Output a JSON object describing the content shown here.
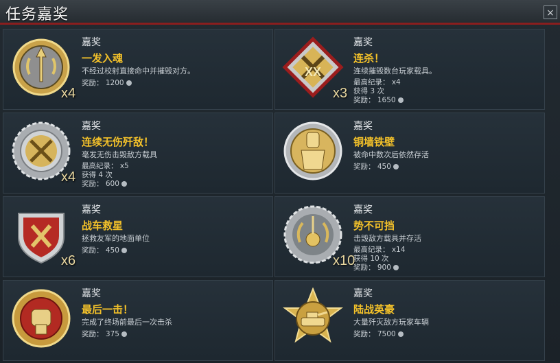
{
  "window": {
    "title": "任务嘉奖",
    "close_icon": "×"
  },
  "cards": [
    {
      "label": "嘉奖",
      "name": "一发入魂",
      "desc": "不经过校射直接命中并摧毁对方。",
      "mult": "x4",
      "stats": [
        {
          "k": "奖励：",
          "v": "1200"
        }
      ]
    },
    {
      "label": "嘉奖",
      "name": "连杀！",
      "desc": "连续摧毁数台玩家载具。",
      "mult": "x3",
      "stats": [
        {
          "k": "最高纪录：",
          "v": "x4"
        },
        {
          "k": "获得",
          "v": "3 次"
        },
        {
          "k": "奖励：",
          "v": "1650"
        }
      ]
    },
    {
      "label": "嘉奖",
      "name": "连续无伤歼敌！",
      "desc": "毫发无伤击毁敌方载具",
      "mult": "x4",
      "stats": [
        {
          "k": "最高纪录：",
          "v": "x5"
        },
        {
          "k": "获得",
          "v": "4 次"
        },
        {
          "k": "奖励：",
          "v": "600"
        }
      ]
    },
    {
      "label": "嘉奖",
      "name": "铜墙铁壁",
      "desc": "被命中数次后依然存活",
      "mult": "",
      "stats": [
        {
          "k": "奖励：",
          "v": "450"
        }
      ]
    },
    {
      "label": "嘉奖",
      "name": "战车救星",
      "desc": "拯救友军的地面单位",
      "mult": "x6",
      "stats": [
        {
          "k": "奖励：",
          "v": "450"
        }
      ]
    },
    {
      "label": "嘉奖",
      "name": "势不可挡",
      "desc": "击毁敌方载具并存活",
      "mult": "x10",
      "stats": [
        {
          "k": "最高纪录：",
          "v": "x14"
        },
        {
          "k": "获得",
          "v": "10 次"
        },
        {
          "k": "奖励：",
          "v": "900"
        }
      ]
    },
    {
      "label": "嘉奖",
      "name": "最后一击！",
      "desc": "完成了终场前最后一次击杀",
      "mult": "",
      "stats": [
        {
          "k": "奖励：",
          "v": "375"
        }
      ]
    },
    {
      "label": "嘉奖",
      "name": "陆战英豪",
      "desc": "大量歼灭敌方玩家车辆",
      "mult": "",
      "stats": [
        {
          "k": "奖励：",
          "v": "7500"
        }
      ]
    }
  ],
  "icons": [
    "arrow-medal-icon",
    "crossed-hammers-medal-icon",
    "crossed-swords-medal-icon",
    "knight-armor-medal-icon",
    "shield-swords-medal-icon",
    "apple-arrow-medal-icon",
    "fist-medal-icon",
    "tank-star-medal-icon"
  ],
  "colors": {
    "accent": "#f3c12a",
    "titlebar_border": "#8a1e1e"
  }
}
